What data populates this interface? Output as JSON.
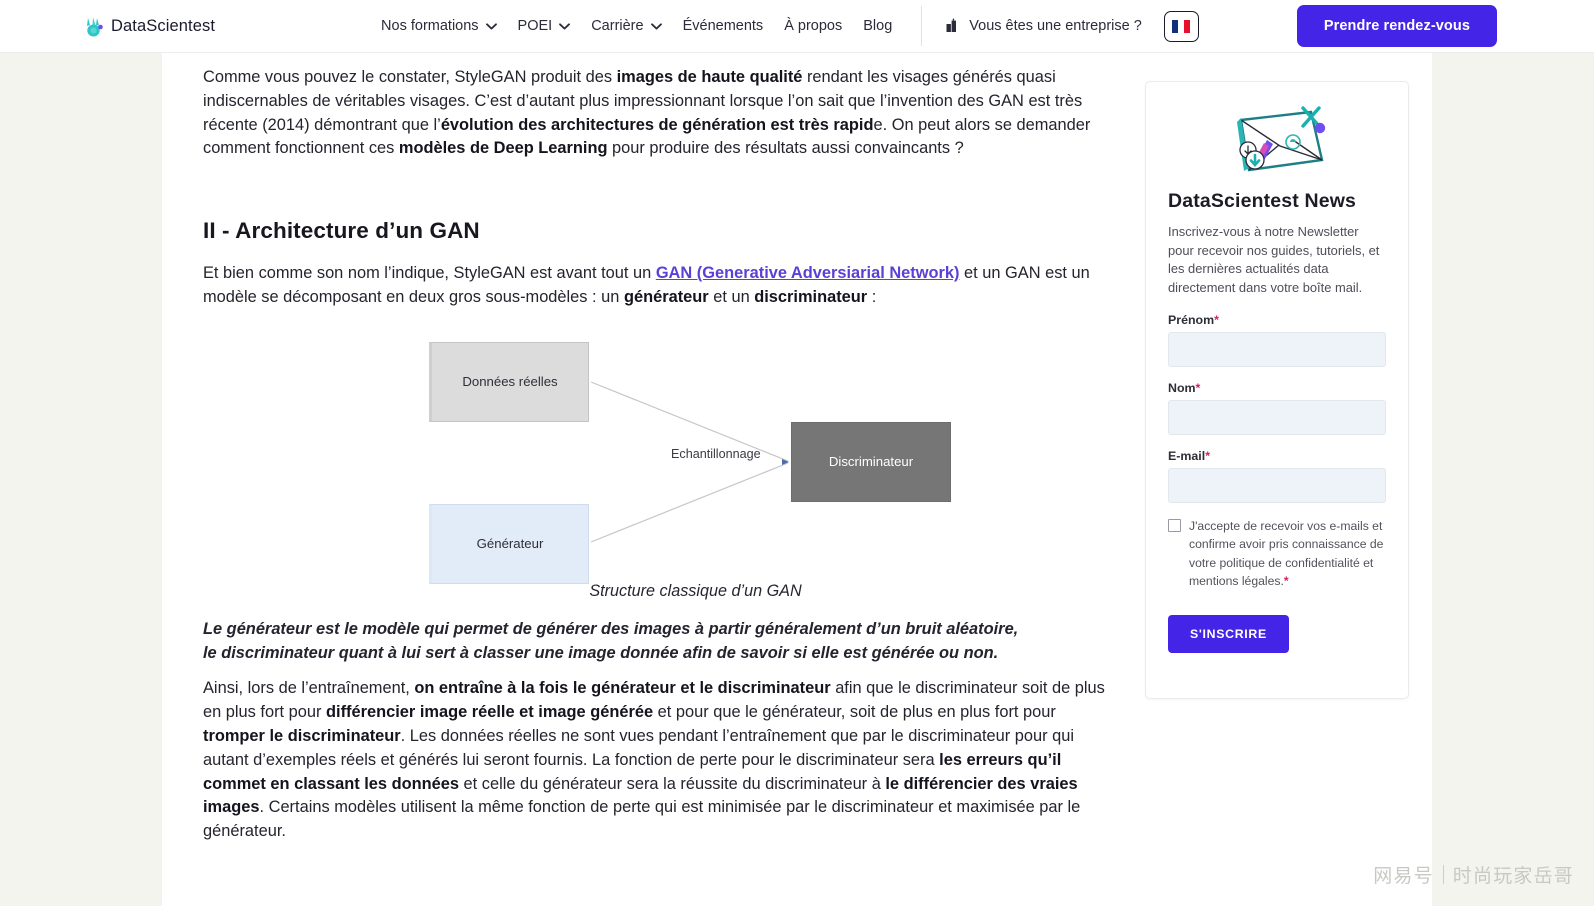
{
  "header": {
    "logo_text": "DataScientest",
    "logo_icon": "datascientest-rabbit-logo",
    "nav": [
      {
        "label": "Nos formations",
        "has_dropdown": true
      },
      {
        "label": "POEI",
        "has_dropdown": true
      },
      {
        "label": "Carrière",
        "has_dropdown": true
      },
      {
        "label": "Événements",
        "has_dropdown": false
      },
      {
        "label": "À propos",
        "has_dropdown": false
      },
      {
        "label": "Blog",
        "has_dropdown": false
      }
    ],
    "enterprise_label": "Vous êtes une entreprise ?",
    "enterprise_icon": "building-icon",
    "language_flag": "fr-flag",
    "cta_label": "Prendre rendez-vous",
    "cta_color": "#4425e8"
  },
  "article": {
    "intro": {
      "part1": "Comme vous pouvez le constater, StyleGAN produit des ",
      "bold1": "images de haute qualité",
      "part2": " rendant les visages générés quasi indiscernables de véritables visages. C’est d’autant plus impressionnant lorsque l’on sait que l’invention des GAN est très récente (2014) démontrant que l’",
      "bold2": "évolution des architectures de génération est très rapid",
      "part3": "e. On peut alors se demander comment fonctionnent ces ",
      "bold3": "modèles de Deep Learning",
      "part4": " pour produire des résultats aussi convaincants ?"
    },
    "section_title": "II - Architecture d’un GAN",
    "section_intro": {
      "part1": "Et bien comme son nom l’indique, StyleGAN est avant tout un ",
      "link": "GAN (Generative Adversiarial Network)",
      "part2": " et un GAN est un modèle se décomposant en deux gros sous-modèles : un ",
      "bold1": "générateur",
      "part3": " et un ",
      "bold2": "discriminateur",
      "part4": " :"
    },
    "quote": "Le générateur est le modèle qui permet de générer des images à partir généralement d’un bruit aléatoire, le discriminateur quant à lui sert à classer une image donnée afin de savoir si elle est générée ou non.",
    "training": {
      "part1": "Ainsi, lors de l’entraînement, ",
      "bold1": "on entraîne à la fois le générateur et le discriminateur",
      "part2": " afin que le discriminateur soit de plus en plus fort pour ",
      "bold2": "différencier image réelle et image générée",
      "part3": " et pour que le générateur, soit de plus en plus fort pour ",
      "bold3": "tromper le discriminateur",
      "part4": ". Les données réelles ne sont vues pendant l’entraînement que par le discriminateur pour qui autant d’exemples réels et générés lui seront fournis. La fonction de perte pour le discriminateur sera ",
      "bold4": "les erreurs qu’il commet en classant les données",
      "part5": " et celle du générateur sera la réussite du discriminateur à ",
      "bold5": "le différencier des vraies images",
      "part6": ". Certains modèles utilisent la même fonction de perte qui est minimisée par le discriminateur et maximisée par le générateur."
    }
  },
  "diagram": {
    "caption": "Structure classique d’un GAN",
    "nodes": [
      {
        "id": "real-data",
        "label": "Données réelles",
        "fill": "#dcdcdc",
        "text_color": "#2f2f37"
      },
      {
        "id": "generator",
        "label": "Générateur",
        "fill": "#e2ecf8",
        "text_color": "#2f2f37"
      },
      {
        "id": "discriminator",
        "label": "Discriminateur",
        "fill": "#767676",
        "text_color": "#ffffff"
      }
    ],
    "edge_label": "Echantillonnage",
    "edges": [
      {
        "from": "real-data",
        "to": "discriminator"
      },
      {
        "from": "generator",
        "to": "discriminator"
      }
    ]
  },
  "newsletter": {
    "icon": "envelope-newsletter-icon",
    "title": "DataScientest News",
    "description": "Inscrivez-vous à notre Newsletter pour recevoir nos guides, tutoriels, et les dernières actualités data directement dans votre boîte mail.",
    "fields": [
      {
        "name": "firstname",
        "label": "Prénom",
        "required": true,
        "value": "",
        "placeholder": ""
      },
      {
        "name": "lastname",
        "label": "Nom",
        "required": true,
        "value": "",
        "placeholder": ""
      },
      {
        "name": "email",
        "label": "E-mail",
        "required": true,
        "value": "",
        "placeholder": ""
      }
    ],
    "consent_text": "J'accepte de recevoir vos e-mails et confirme avoir pris connaissance de votre politique de confidentialité et mentions légales.",
    "consent_required_mark": "*",
    "consent_checked": false,
    "submit_label": "S'INSCRIRE",
    "required_mark": "*"
  },
  "watermark": {
    "left": "网易号",
    "right": "时尚玩家岳哥"
  }
}
